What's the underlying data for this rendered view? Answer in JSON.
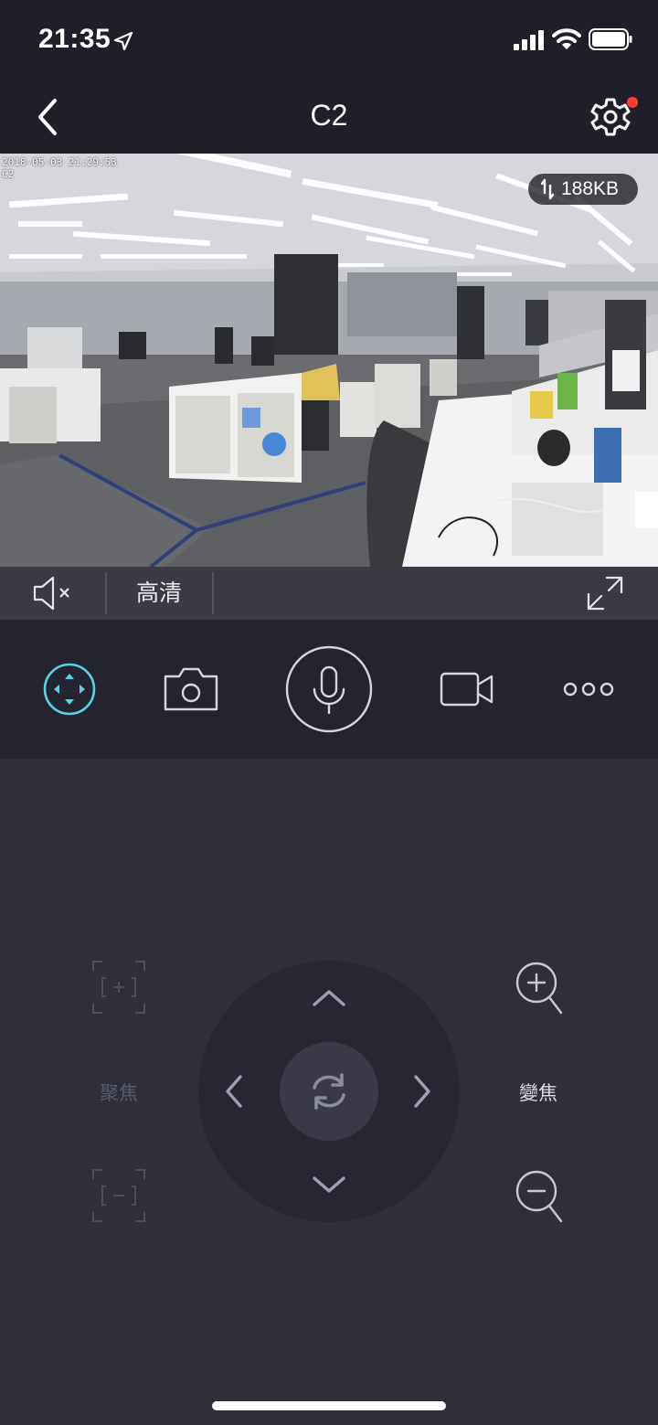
{
  "status_bar": {
    "time": "21:35",
    "icons": [
      "location-arrow-icon",
      "cellular-signal-icon",
      "wifi-icon",
      "battery-icon"
    ]
  },
  "nav": {
    "back_icon": "chevron-left-icon",
    "title": "C2",
    "settings_icon": "gear-icon",
    "settings_badge_color": "#ff3b30"
  },
  "video": {
    "timestamp": "2018-05-03 21:29:53",
    "camera_label": "C2",
    "bitrate": "188KB",
    "bitrate_icon": "lightning-arrows-icon"
  },
  "video_controls": {
    "mute_icon": "speaker-muted-icon",
    "quality_label": "高清",
    "fullscreen_icon": "expand-icon"
  },
  "toolbar": {
    "items": [
      {
        "name": "ptz",
        "icon": "ptz-direction-icon",
        "active": true
      },
      {
        "name": "snapshot",
        "icon": "camera-icon",
        "active": false
      },
      {
        "name": "talk",
        "icon": "microphone-icon",
        "active": false
      },
      {
        "name": "record",
        "icon": "video-camera-icon",
        "active": false
      },
      {
        "name": "more",
        "icon": "more-dots-icon",
        "active": false
      }
    ],
    "active_color": "#5ad2e6"
  },
  "ptz": {
    "focus_label": "聚焦",
    "focus_in_icon": "focus-plus-icon",
    "focus_out_icon": "focus-minus-icon",
    "zoom_label": "變焦",
    "zoom_in_icon": "zoom-in-icon",
    "zoom_out_icon": "zoom-out-icon",
    "center_icon": "reset-refresh-icon",
    "arrows": [
      "up",
      "down",
      "left",
      "right"
    ]
  }
}
